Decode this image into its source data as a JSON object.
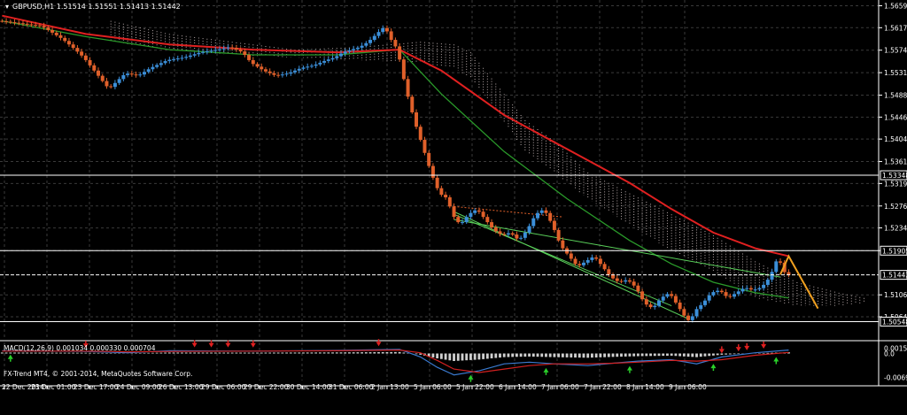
{
  "window": {
    "title": "GBPUSD,H1  1.51514 1.51551 1.51413 1.51442",
    "copyright": "FX-Trend MT4, © 2001-2014, MetaQuotes Software Corp."
  },
  "colors": {
    "background": "#000000",
    "grid": "#3a3a3a",
    "bull": "#3b8fd9",
    "bear": "#e0602a",
    "ma_fast": "#e02020",
    "ma_slow": "#2a9a2a",
    "cloud": "#d8c8c8",
    "forecast": "#f0a020",
    "trendline": "#5ad05a",
    "macd_signal": "#d02020",
    "macd_line": "#3a7ad0",
    "macd_hist": "#cfcfcf",
    "arrow_up": "#2ad02a",
    "arrow_down": "#e02020"
  },
  "chart_data": [
    {
      "type": "line",
      "ylim": [
        1.502,
        1.567
      ],
      "y_ticks": [
        "1.56590",
        "1.56170",
        "1.55740",
        "1.55310",
        "1.54880",
        "1.54460",
        "1.54040",
        "1.53610",
        "1.53190",
        "1.52760",
        "1.52340",
        "1.51905",
        "1.51060",
        "1.50640"
      ],
      "x_labels": [
        "22 Dec 2014",
        "23 Dec 01:00",
        "23 Dec 17:00",
        "24 Dec 09:00",
        "26 Dec 13:00",
        "29 Dec 06:00",
        "29 Dec 22:00",
        "30 Dec 14:00",
        "31 Dec 06:00",
        "2 Jan 13:00",
        "5 Jan 06:00",
        "5 Jan 22:00",
        "6 Jan 14:00",
        "7 Jan 06:00",
        "7 Jan 22:00",
        "8 Jan 14:00",
        "9 Jan 06:00"
      ],
      "horizontal_levels": [
        {
          "value": 1.53348,
          "label": "1.53348"
        },
        {
          "value": 1.51905,
          "label": "1.51905"
        },
        {
          "value": 1.51442,
          "label": "1.51442",
          "current": true
        },
        {
          "value": 1.50548,
          "label": "1.50548"
        }
      ],
      "price_path": [
        [
          0,
          1.563
        ],
        [
          5,
          1.5625
        ],
        [
          10,
          1.562
        ],
        [
          15,
          1.5595
        ],
        [
          18,
          1.5575
        ],
        [
          20,
          1.556
        ],
        [
          22,
          1.554
        ],
        [
          24,
          1.552
        ],
        [
          26,
          1.55
        ],
        [
          28,
          1.5515
        ],
        [
          30,
          1.553
        ],
        [
          33,
          1.5525
        ],
        [
          36,
          1.554
        ],
        [
          40,
          1.5555
        ],
        [
          44,
          1.556
        ],
        [
          48,
          1.557
        ],
        [
          52,
          1.5575
        ],
        [
          55,
          1.558
        ],
        [
          58,
          1.557
        ],
        [
          60,
          1.555
        ],
        [
          63,
          1.5535
        ],
        [
          66,
          1.5525
        ],
        [
          69,
          1.553
        ],
        [
          72,
          1.554
        ],
        [
          75,
          1.5545
        ],
        [
          78,
          1.5555
        ],
        [
          80,
          1.556
        ],
        [
          82,
          1.557
        ],
        [
          84,
          1.5575
        ],
        [
          86,
          1.558
        ],
        [
          88,
          1.559
        ],
        [
          90,
          1.5605
        ],
        [
          92,
          1.562
        ],
        [
          93,
          1.56
        ],
        [
          95,
          1.5575
        ],
        [
          97,
          1.55
        ],
        [
          99,
          1.544
        ],
        [
          101,
          1.539
        ],
        [
          103,
          1.534
        ],
        [
          105,
          1.53
        ],
        [
          107,
          1.529
        ],
        [
          108,
          1.526
        ],
        [
          110,
          1.524
        ],
        [
          112,
          1.526
        ],
        [
          114,
          1.527
        ],
        [
          116,
          1.525
        ],
        [
          118,
          1.523
        ],
        [
          120,
          1.522
        ],
        [
          122,
          1.5225
        ],
        [
          124,
          1.521
        ],
        [
          126,
          1.523
        ],
        [
          128,
          1.526
        ],
        [
          130,
          1.527
        ],
        [
          132,
          1.524
        ],
        [
          134,
          1.52
        ],
        [
          136,
          1.518
        ],
        [
          138,
          1.516
        ],
        [
          140,
          1.517
        ],
        [
          142,
          1.518
        ],
        [
          144,
          1.516
        ],
        [
          146,
          1.514
        ],
        [
          148,
          1.513
        ],
        [
          150,
          1.5135
        ],
        [
          152,
          1.512
        ],
        [
          154,
          1.509
        ],
        [
          156,
          1.508
        ],
        [
          158,
          1.51
        ],
        [
          160,
          1.511
        ],
        [
          162,
          1.5085
        ],
        [
          164,
          1.506
        ],
        [
          165,
          1.5055
        ],
        [
          166,
          1.5075
        ],
        [
          168,
          1.509
        ],
        [
          170,
          1.511
        ],
        [
          172,
          1.5115
        ],
        [
          174,
          1.51
        ],
        [
          176,
          1.511
        ],
        [
          178,
          1.512
        ],
        [
          180,
          1.5115
        ],
        [
          182,
          1.512
        ],
        [
          184,
          1.514
        ],
        [
          185,
          1.516
        ],
        [
          186,
          1.518
        ],
        [
          187,
          1.5155
        ],
        [
          188,
          1.5144
        ]
      ],
      "ma_fast": [
        [
          0,
          1.564
        ],
        [
          20,
          1.5605
        ],
        [
          40,
          1.5585
        ],
        [
          60,
          1.5575
        ],
        [
          80,
          1.557
        ],
        [
          95,
          1.5575
        ],
        [
          105,
          1.5535
        ],
        [
          120,
          1.545
        ],
        [
          135,
          1.5385
        ],
        [
          150,
          1.532
        ],
        [
          160,
          1.527
        ],
        [
          170,
          1.5225
        ],
        [
          180,
          1.5195
        ],
        [
          188,
          1.518
        ]
      ],
      "ma_slow": [
        [
          0,
          1.563
        ],
        [
          20,
          1.56
        ],
        [
          40,
          1.5575
        ],
        [
          60,
          1.5565
        ],
        [
          80,
          1.5565
        ],
        [
          95,
          1.5575
        ],
        [
          105,
          1.549
        ],
        [
          120,
          1.538
        ],
        [
          135,
          1.529
        ],
        [
          150,
          1.521
        ],
        [
          160,
          1.5165
        ],
        [
          170,
          1.513
        ],
        [
          180,
          1.511
        ],
        [
          188,
          1.51
        ]
      ],
      "cloud_upper": [
        [
          26,
          1.563
        ],
        [
          40,
          1.5605
        ],
        [
          55,
          1.559
        ],
        [
          70,
          1.5575
        ],
        [
          85,
          1.558
        ],
        [
          100,
          1.559
        ],
        [
          108,
          1.5585
        ],
        [
          112,
          1.557
        ],
        [
          118,
          1.551
        ],
        [
          125,
          1.544
        ],
        [
          132,
          1.54
        ],
        [
          140,
          1.534
        ],
        [
          150,
          1.53
        ],
        [
          160,
          1.526
        ],
        [
          170,
          1.522
        ],
        [
          180,
          1.517
        ],
        [
          190,
          1.513
        ],
        [
          200,
          1.511
        ],
        [
          206,
          1.51
        ]
      ],
      "cloud_lower": [
        [
          26,
          1.559
        ],
        [
          40,
          1.5575
        ],
        [
          55,
          1.5565
        ],
        [
          70,
          1.556
        ],
        [
          85,
          1.5555
        ],
        [
          100,
          1.555
        ],
        [
          108,
          1.554
        ],
        [
          112,
          1.552
        ],
        [
          118,
          1.546
        ],
        [
          125,
          1.538
        ],
        [
          132,
          1.534
        ],
        [
          140,
          1.529
        ],
        [
          150,
          1.524
        ],
        [
          160,
          1.519
        ],
        [
          170,
          1.515
        ],
        [
          180,
          1.51
        ],
        [
          190,
          1.5085
        ],
        [
          200,
          1.5085
        ],
        [
          206,
          1.509
        ]
      ],
      "forecast": [
        [
          186,
          1.5145
        ],
        [
          188,
          1.518
        ],
        [
          195,
          1.508
        ]
      ],
      "trendlines": [
        [
          [
            108,
            1.5265
          ],
          [
            164,
            1.506
          ]
        ],
        [
          [
            108,
            1.525
          ],
          [
            186,
            1.514
          ]
        ],
        [
          [
            108,
            1.526
          ],
          [
            160,
            1.5085
          ]
        ],
        [
          [
            108,
            1.5275
          ],
          [
            134,
            1.5255
          ]
        ]
      ]
    },
    {
      "type": "bar",
      "title": "MACD(12,26,9) 0.001034 0.000330 0.000704",
      "ylim": [
        -0.0078,
        0.0032
      ],
      "y_ticks": [
        "0.00152",
        "0.0",
        "-0.00690"
      ],
      "macd_line": [
        [
          0,
          0.0008
        ],
        [
          20,
          0.0006
        ],
        [
          30,
          0.0002
        ],
        [
          40,
          0.0008
        ],
        [
          60,
          0.0007
        ],
        [
          80,
          0.0009
        ],
        [
          95,
          0.0012
        ],
        [
          100,
          -0.001
        ],
        [
          104,
          -0.004
        ],
        [
          108,
          -0.0062
        ],
        [
          114,
          -0.005
        ],
        [
          120,
          -0.003
        ],
        [
          126,
          -0.0025
        ],
        [
          132,
          -0.003
        ],
        [
          140,
          -0.0035
        ],
        [
          146,
          -0.0028
        ],
        [
          152,
          -0.0022
        ],
        [
          160,
          -0.0018
        ],
        [
          166,
          -0.003
        ],
        [
          172,
          -0.001
        ],
        [
          180,
          0.0002
        ],
        [
          188,
          0.001
        ]
      ],
      "signal_line": [
        [
          0,
          0.0007
        ],
        [
          20,
          0.0007
        ],
        [
          30,
          0.0005
        ],
        [
          40,
          0.0006
        ],
        [
          60,
          0.0007
        ],
        [
          80,
          0.0008
        ],
        [
          95,
          0.001
        ],
        [
          100,
          0.0002
        ],
        [
          104,
          -0.002
        ],
        [
          108,
          -0.0045
        ],
        [
          114,
          -0.0055
        ],
        [
          120,
          -0.0045
        ],
        [
          126,
          -0.0035
        ],
        [
          132,
          -0.003
        ],
        [
          140,
          -0.003
        ],
        [
          146,
          -0.0028
        ],
        [
          152,
          -0.0025
        ],
        [
          160,
          -0.002
        ],
        [
          166,
          -0.0022
        ],
        [
          172,
          -0.0018
        ],
        [
          180,
          -0.0005
        ],
        [
          188,
          0.0003
        ]
      ],
      "arrows_up": [
        2,
        112,
        130,
        150,
        170,
        185
      ],
      "arrows_down": [
        20,
        46,
        50,
        54,
        60,
        90,
        172,
        176,
        178,
        182
      ]
    }
  ]
}
